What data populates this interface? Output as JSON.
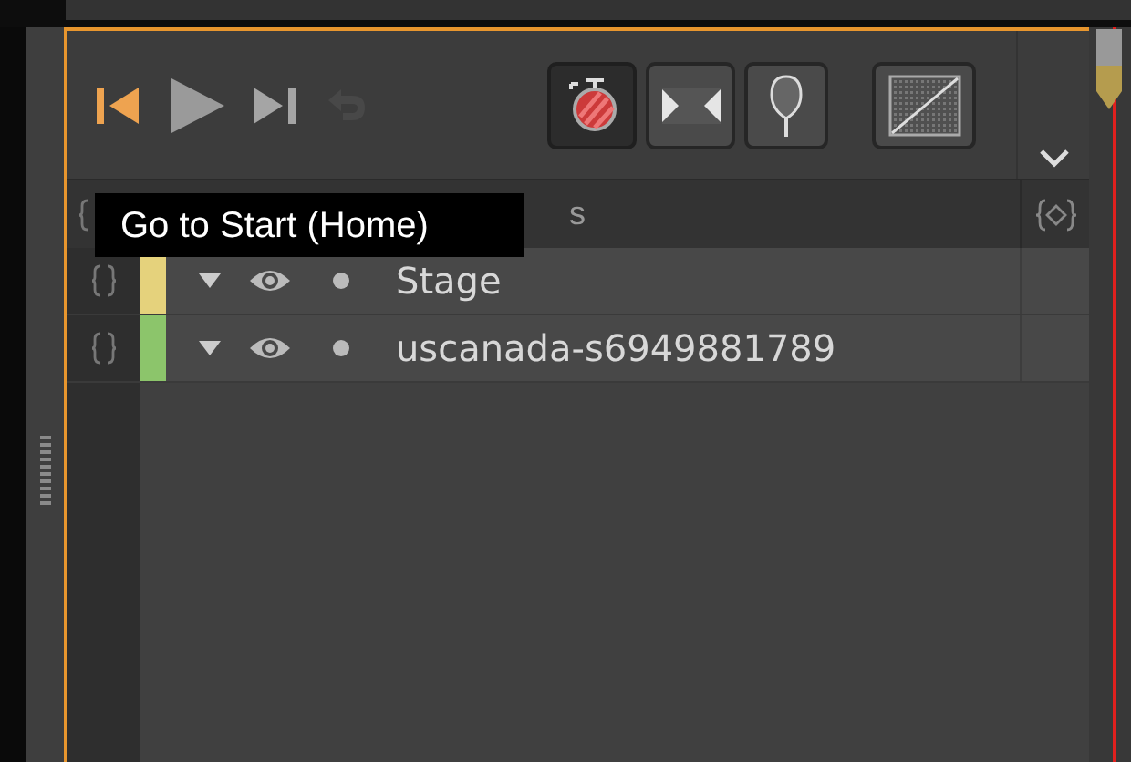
{
  "transport": [
    {
      "kind": "start",
      "active": true
    },
    {
      "kind": "play",
      "active": true
    },
    {
      "kind": "end",
      "active": true
    },
    {
      "kind": "undo",
      "active": false
    }
  ],
  "tools": [
    {
      "kind": "record",
      "selected": true
    },
    {
      "kind": "bounds",
      "selected": false
    },
    {
      "kind": "pin",
      "selected": false
    },
    {
      "kind": "ease",
      "selected": false
    }
  ],
  "header": {
    "label": "s"
  },
  "tooltip": "Go to Start (Home)",
  "layers": [
    {
      "name": "Stage",
      "color": "#e5d27c",
      "expanded": true
    },
    {
      "name": "uscanada-s6949881789",
      "color": "#8cc56b",
      "expanded": true
    }
  ]
}
